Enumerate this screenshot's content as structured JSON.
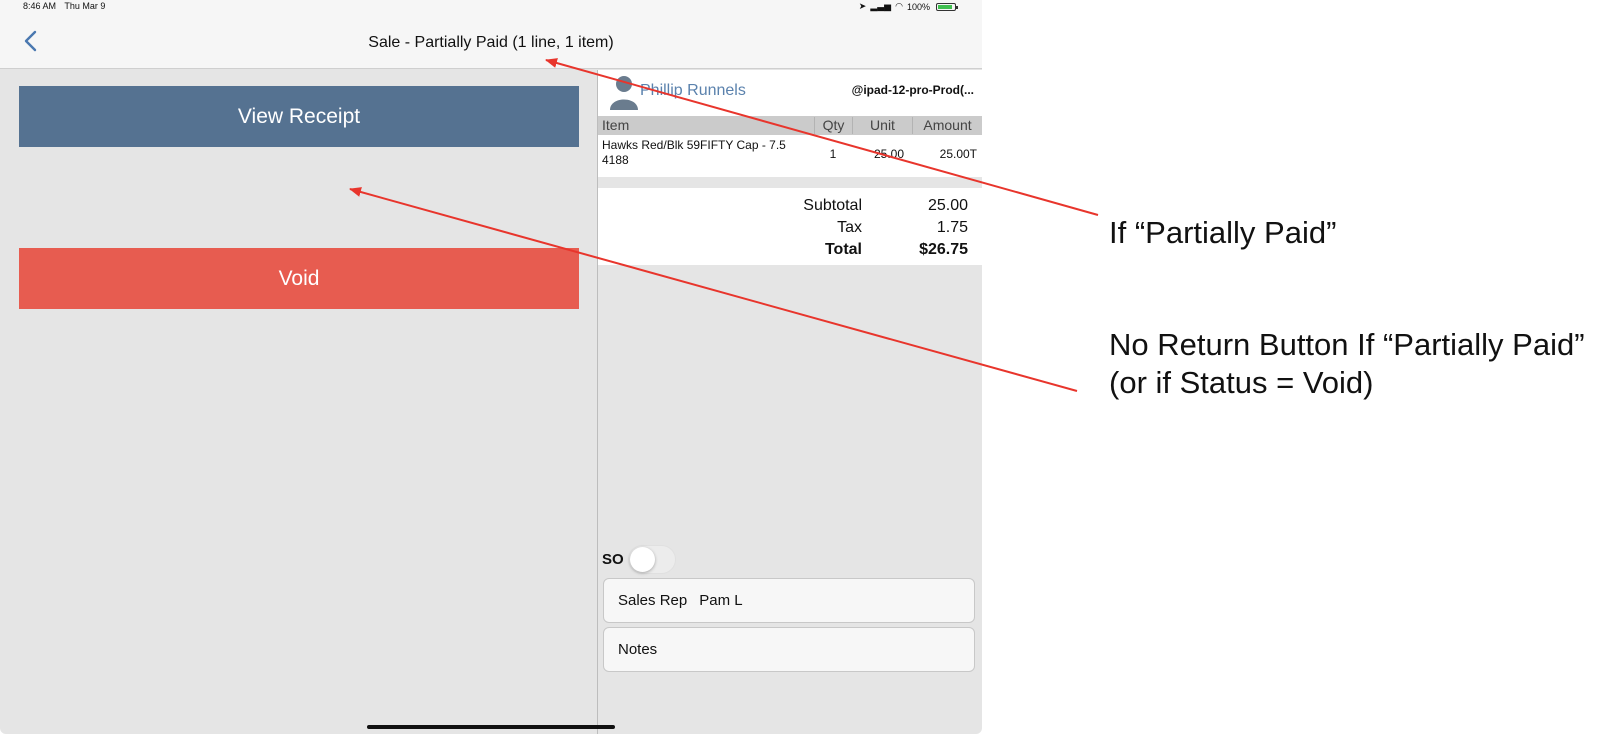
{
  "status_bar": {
    "time": "8:46 AM",
    "date": "Thu Mar 9",
    "battery": "100%"
  },
  "nav": {
    "title": "Sale - Partially Paid (1 line, 1 item)",
    "back_icon": "chevron-left-icon"
  },
  "actions": {
    "view_receipt_label": "View Receipt",
    "void_label": "Void"
  },
  "colors": {
    "receipt_button": "#557291",
    "void_button": "#e75c50",
    "customer_link": "#5b82ad",
    "annotation_arrow": "#e8352c"
  },
  "customer": {
    "name": "Phillip Runnels",
    "device": "@ipad-12-pro-Prod(..."
  },
  "table": {
    "headers": {
      "item": "Item",
      "qty": "Qty",
      "unit": "Unit",
      "amount": "Amount"
    },
    "rows": [
      {
        "item": "Hawks Red/Blk 59FIFTY Cap - 7.5 4188",
        "qty": "1",
        "unit": "25.00",
        "amount": "25.00T"
      }
    ]
  },
  "totals": {
    "subtotal_label": "Subtotal",
    "subtotal": "25.00",
    "tax_label": "Tax",
    "tax": "1.75",
    "total_label": "Total",
    "total": "$26.75"
  },
  "so": {
    "label": "SO"
  },
  "fields": {
    "sales_rep_label": "Sales Rep",
    "sales_rep_value": "Pam L",
    "notes_label": "Notes"
  },
  "annotations": {
    "first": "If “Partially Paid”",
    "second_line1": "No Return Button  If “Partially Paid”",
    "second_line2": "(or if Status = Void)"
  }
}
